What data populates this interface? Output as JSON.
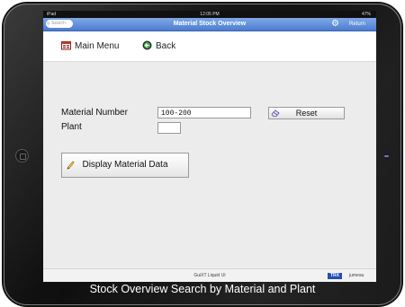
{
  "status_bar": {
    "carrier": "iPad",
    "time": "12:05 PM",
    "battery": "47%"
  },
  "title_bar": {
    "search_placeholder": "Search",
    "title": "Material Stock Overview",
    "return_label": "Return"
  },
  "toolbar": {
    "main_menu_label": "Main Menu",
    "back_label": "Back"
  },
  "form": {
    "material_number_label": "Material Number",
    "material_number_value": "100-200",
    "plant_label": "Plant",
    "plant_value": "",
    "reset_label": "Reset",
    "display_label": "Display Material Data"
  },
  "footer": {
    "brand": "GuiXT Liquid UI",
    "transaction": "TRX",
    "user": "jumeau"
  },
  "caption": "Stock Overview Search by Material and Plant",
  "colors": {
    "title_bar": "#4c7cd0",
    "content_bg": "#ececec",
    "trx_badge": "#2450b5"
  }
}
